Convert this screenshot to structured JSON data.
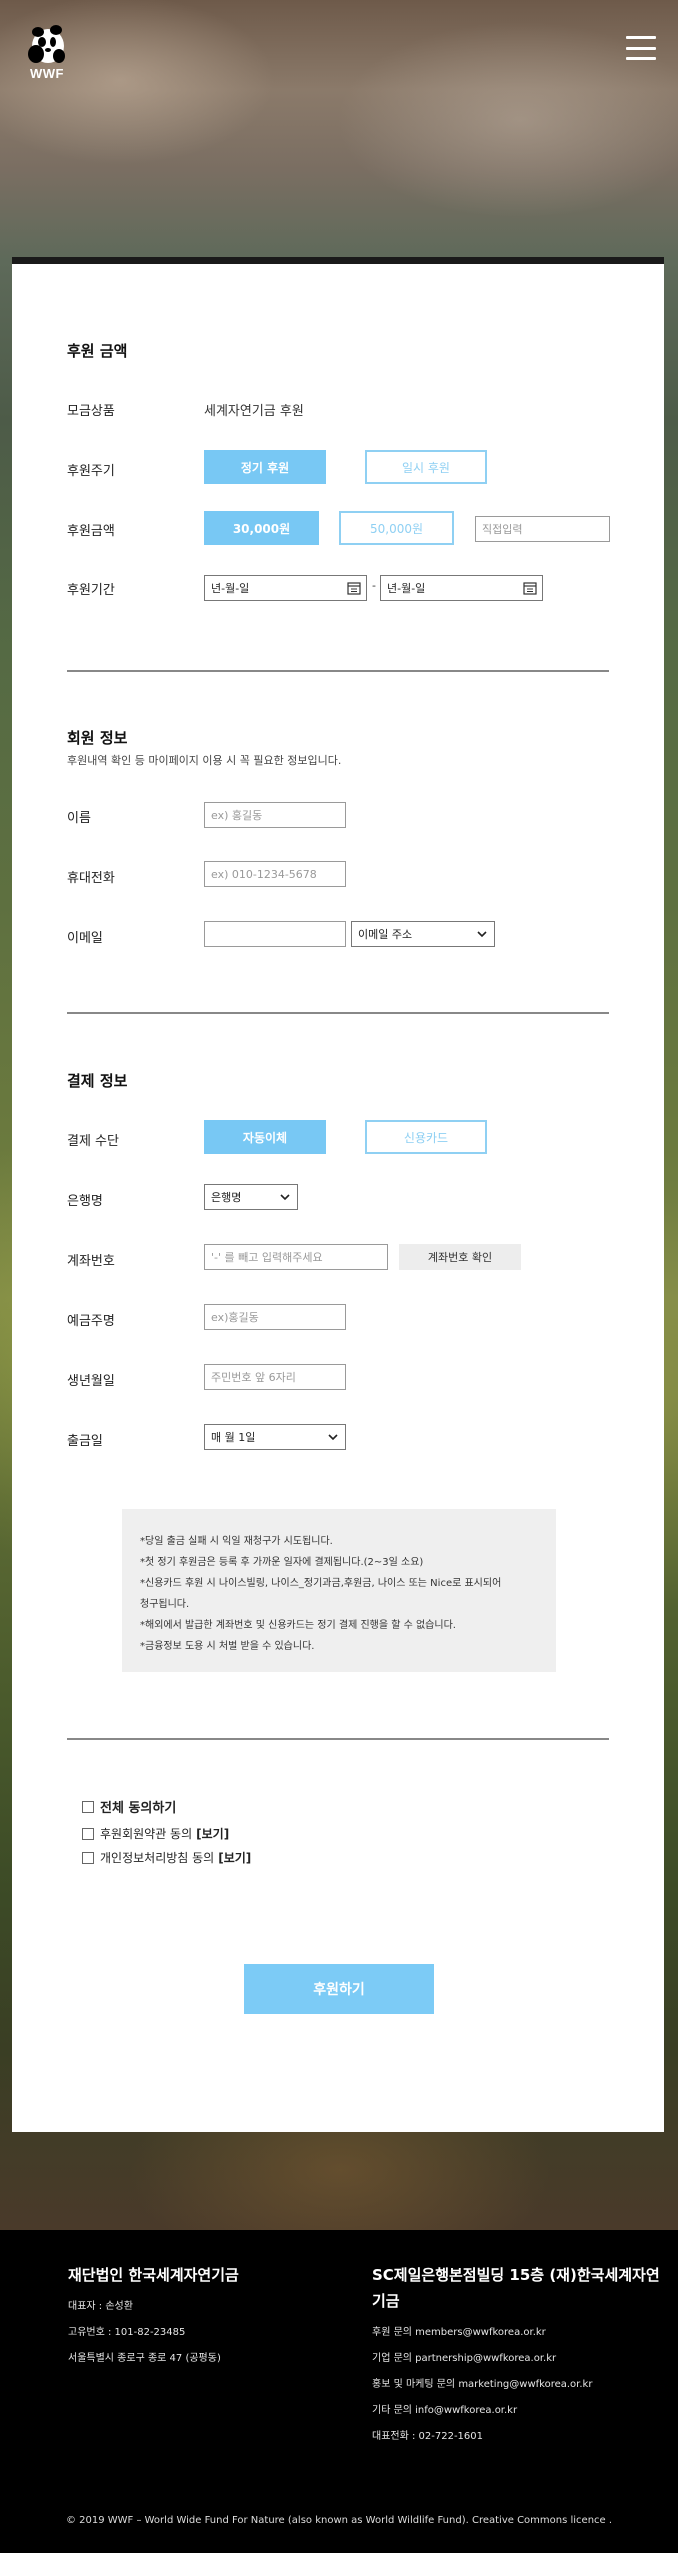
{
  "header": {
    "logo_text": "WWF"
  },
  "colors": {
    "accent": "#78c8f4",
    "accent_outline": "#8fd0f3",
    "footer_bg": "#000000"
  },
  "donation": {
    "title": "후원 금액",
    "product_label": "모금상품",
    "product_value": "세계자연기금 후원",
    "period_label": "후원주기",
    "period_options": [
      "정기 후원",
      "일시 후원"
    ],
    "amount_label": "후원금액",
    "amount_options": [
      "30,000원",
      "50,000원"
    ],
    "amount_custom_placeholder": "직접입력",
    "term_label": "후원기간",
    "date_start_placeholder": "년-월-일",
    "date_separator": "-",
    "date_end_placeholder": "년-월-일"
  },
  "member": {
    "title": "회원 정보",
    "description": "후원내역 확인 등 마이페이지 이용 시 꼭 필요한 정보입니다.",
    "name_label": "이름",
    "name_placeholder": "ex) 홍길동",
    "phone_label": "휴대전화",
    "phone_placeholder": "ex) 010-1234-5678",
    "email_label": "이메일",
    "email_domain_select": "이메일 주소"
  },
  "payment": {
    "title": "결제 정보",
    "method_label": "결제 수단",
    "method_options": [
      "자동이체",
      "신용카드"
    ],
    "bank_label": "은행명",
    "bank_select": "은행명",
    "account_label": "계좌번호",
    "account_placeholder": "'-' 를 빼고 입력해주세요",
    "account_verify_button": "계좌번호 확인",
    "holder_label": "예금주명",
    "holder_placeholder": "ex)홍길동",
    "birth_label": "생년월일",
    "birth_placeholder": "주민번호 앞 6자리",
    "withdraw_label": "출금일",
    "withdraw_select": "매 월 1일"
  },
  "notice_lines": [
    "*당일 출금 실패 시 익일 재청구가 시도됩니다.",
    "*첫 정기 후원금은 등록 후 가까운 일자에 결제됩니다.(2~3일 소요)",
    "*신용카드 후원 시 나이스빌링, 나이스_정기과금,후원금, 나이스 또는 Nice로 표시되어",
    "청구됩니다.",
    "*해외에서 발급한 계좌번호 및 신용카드는 정기 결제 진행을 할 수 없습니다.",
    "*금융정보 도용 시 처벌 받을 수 있습니다."
  ],
  "agreements": {
    "all": "전체 동의하기",
    "items": [
      {
        "label": "후원회원약관 동의",
        "view": "[보기]"
      },
      {
        "label": "개인정보처리방침 동의",
        "view": "[보기]"
      }
    ]
  },
  "submit_label": "후원하기",
  "footer": {
    "org_name": "재단법인 한국세계자연기금",
    "ceo": "대표자 : 손성환",
    "biz_no": "고유번호 : 101-82-23485",
    "address": "서울특별시 종로구 종로 47 (공평동)",
    "building_title_1": "SC제일은행본점빌딩 15층 (재)한국세계자연",
    "building_title_2": "기금",
    "contact_support": "후원 문의 members@wwfkorea.or.kr",
    "contact_partnership": "기업 문의 partnership@wwfkorea.or.kr",
    "contact_marketing": "홍보 및 마케팅 문의 marketing@wwfkorea.or.kr",
    "contact_other": "기타 문의 info@wwfkorea.or.kr",
    "phone": "대표전화 : 02-722-1601",
    "copyright": "© 2019 WWF – World Wide Fund For Nature (also known as World Wildlife Fund). Creative Commons licence ."
  }
}
